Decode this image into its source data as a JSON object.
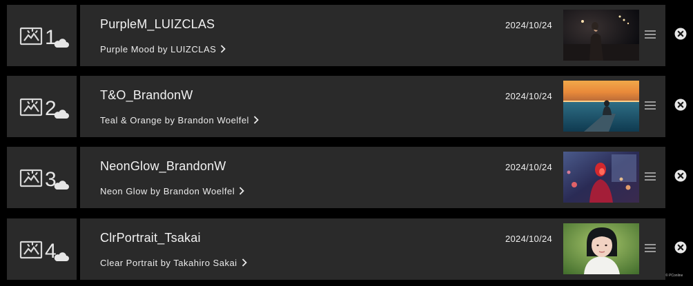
{
  "presets": [
    {
      "slot": "1",
      "name": "PurpleM_LUIZCLAS",
      "link_label": "Purple Mood by LUIZCLAS",
      "date": "2024/10/24",
      "thumbnail": "woman-in-night-tunnel"
    },
    {
      "slot": "2",
      "name": "T&O_BrandonW",
      "link_label": "Teal & Orange by Brandon Woelfel",
      "date": "2024/10/24",
      "thumbnail": "person-on-pier-at-sunset"
    },
    {
      "slot": "3",
      "name": "NeonGlow_BrandonW",
      "link_label": "Neon Glow by Brandon Woelfel",
      "date": "2024/10/24",
      "thumbnail": "woman-in-neon-city-night"
    },
    {
      "slot": "4",
      "name": "ClrPortrait_Tsakai",
      "link_label": "Clear Portrait by Takahiro Sakai",
      "date": "2024/10/24",
      "thumbnail": "portrait-with-green-background"
    }
  ],
  "icons": {
    "slot": "image-cloud-icon",
    "link": "chevron-right-icon",
    "reorder": "drag-handle-icon",
    "remove": "close-circle-icon"
  },
  "watermark": "© PConline"
}
